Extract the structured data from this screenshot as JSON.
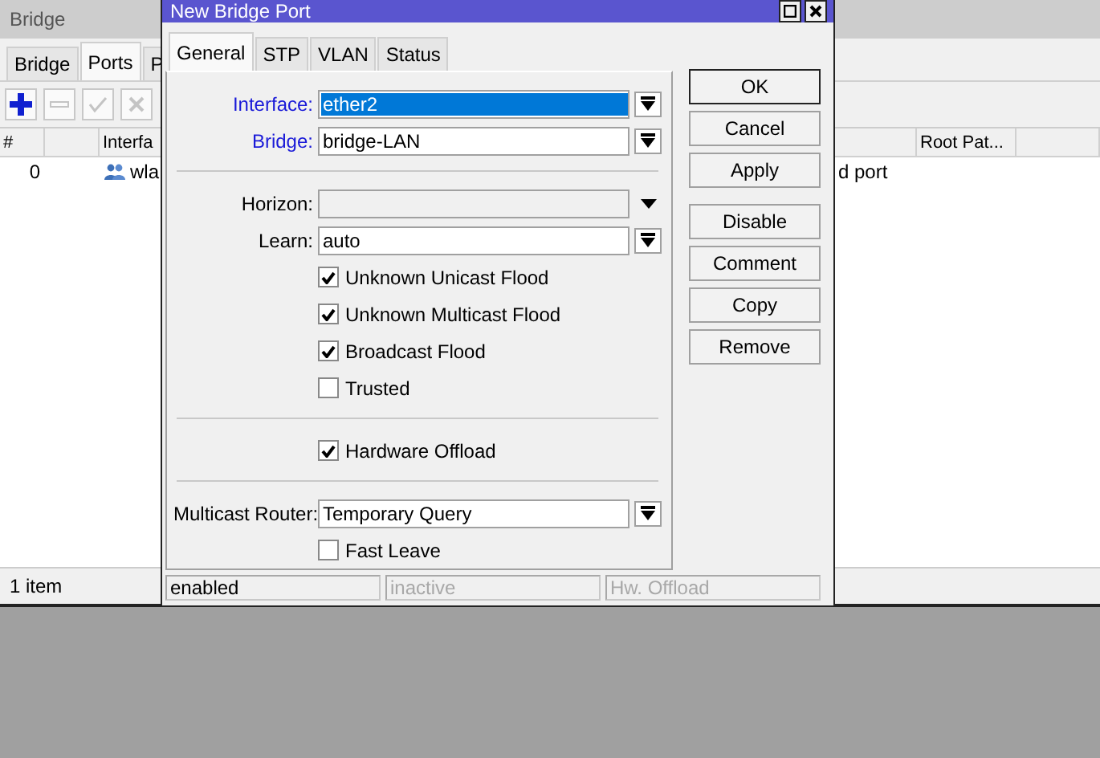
{
  "background_window": {
    "title": "Bridge",
    "tabs": [
      {
        "label": "Bridge",
        "selected": false
      },
      {
        "label": "Ports",
        "selected": true
      },
      {
        "label": "P",
        "selected": false
      }
    ],
    "toolbar": [
      {
        "kind": "add",
        "disabled": false
      },
      {
        "kind": "remove",
        "disabled": true
      },
      {
        "kind": "enable",
        "disabled": true
      },
      {
        "kind": "disable",
        "disabled": true
      }
    ],
    "table": {
      "columns": [
        {
          "label": "#"
        },
        {
          "label": "Interfa"
        },
        {
          "label": "Root Pat..."
        }
      ],
      "rows": [
        {
          "number": "0",
          "interface": "wla",
          "column_4": "d port"
        }
      ]
    },
    "status_bar": "1 item"
  },
  "dialog": {
    "title": "New Bridge Port",
    "tabs": [
      {
        "label": "General",
        "selected": true
      },
      {
        "label": "STP",
        "selected": false
      },
      {
        "label": "VLAN",
        "selected": false
      },
      {
        "label": "Status",
        "selected": false
      }
    ],
    "fields": [
      {
        "kind": "dropdown",
        "label": "Interface:",
        "value": "ether2",
        "required": true,
        "value_selected": true
      },
      {
        "kind": "dropdown",
        "label": "Bridge:",
        "value": "bridge-LAN",
        "required": true,
        "value_selected": false
      },
      {
        "kind": "divider"
      },
      {
        "kind": "dropdown",
        "label": "Horizon:",
        "disabled": true
      },
      {
        "kind": "dropdown",
        "label": "Learn:",
        "value": "auto",
        "required": false,
        "value_selected": false
      },
      {
        "kind": "checkbox",
        "label": "Unknown Unicast Flood",
        "checked": true
      },
      {
        "kind": "checkbox",
        "label": "Unknown Multicast Flood",
        "checked": true
      },
      {
        "kind": "checkbox",
        "label": "Broadcast Flood",
        "checked": true
      },
      {
        "kind": "checkbox",
        "label": "Trusted",
        "checked": false
      },
      {
        "kind": "divider"
      },
      {
        "kind": "checkbox",
        "label": "Hardware Offload",
        "checked": true
      },
      {
        "kind": "divider"
      },
      {
        "kind": "dropdown",
        "label": "Multicast Router:",
        "value": "Temporary Query",
        "required": false,
        "value_selected": false
      },
      {
        "kind": "checkbox",
        "label": "Fast Leave",
        "checked": false
      }
    ],
    "button_groups": [
      [
        {
          "label": "OK",
          "default": true
        },
        {
          "label": "Cancel",
          "default": false
        },
        {
          "label": "Apply",
          "default": false
        }
      ],
      [
        {
          "label": "Disable",
          "default": false
        },
        {
          "label": "Comment",
          "default": false
        },
        {
          "label": "Copy",
          "default": false
        },
        {
          "label": "Remove",
          "default": false
        }
      ]
    ],
    "status_bar": [
      {
        "text": "enabled",
        "active": true
      },
      {
        "text": "inactive",
        "active": false
      },
      {
        "text": "Hw. Offload",
        "active": false
      }
    ]
  }
}
